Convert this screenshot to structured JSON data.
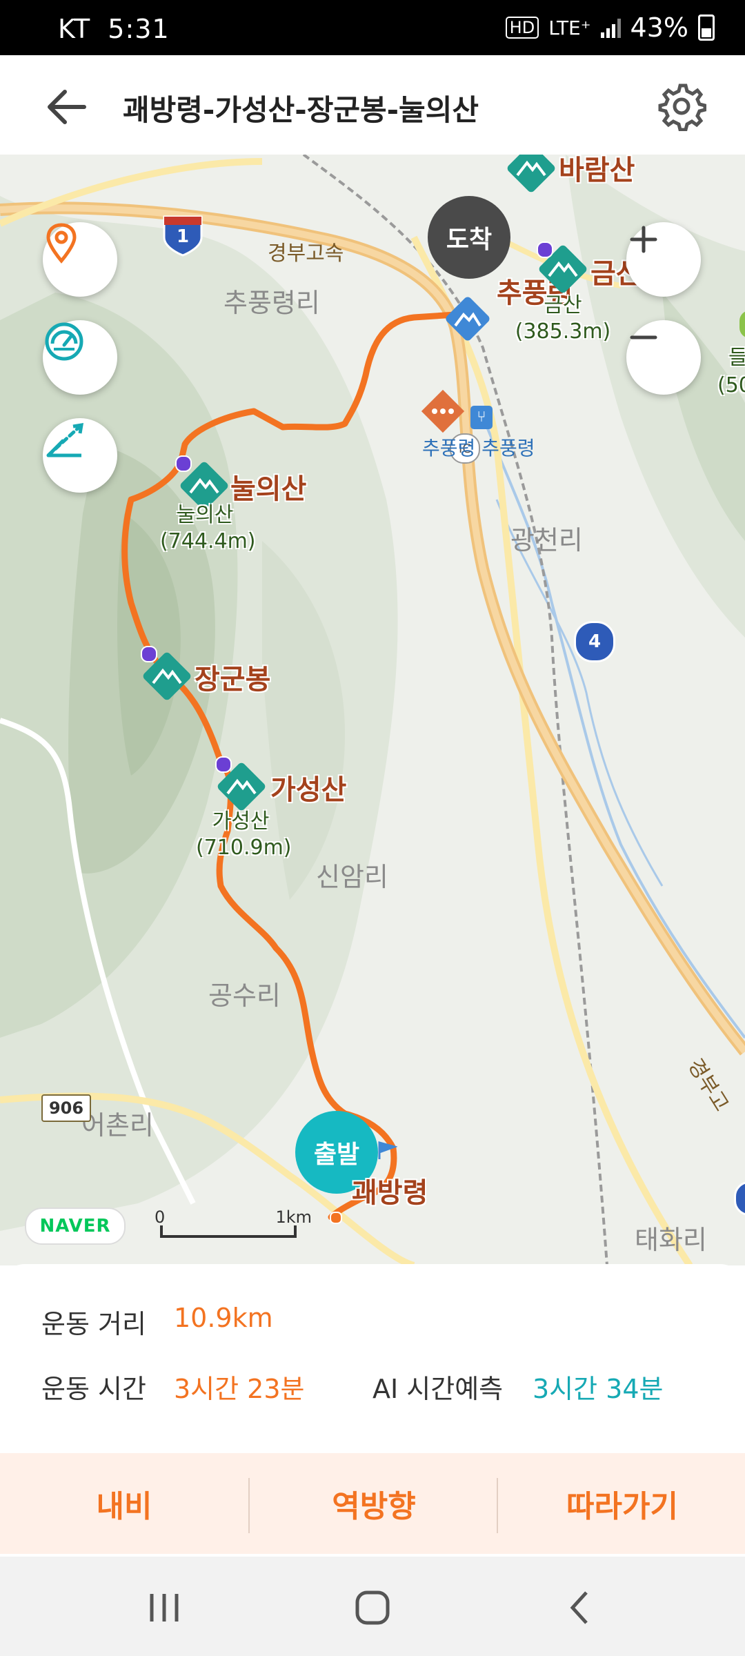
{
  "status": {
    "carrier": "KT",
    "time": "5:31",
    "hd": "HD",
    "network": "LTE⁺",
    "battery": "43%"
  },
  "header": {
    "title": "괘방령-가성산-장군봉-눌의산"
  },
  "map": {
    "place_labels": [
      "추풍령리",
      "광천리",
      "신암리",
      "공수리",
      "어촌리",
      "태화리"
    ],
    "peaks": [
      {
        "name": "눌의산",
        "sub_name": "눌의산",
        "elevation": "(744.4m)"
      },
      {
        "name": "장군봉"
      },
      {
        "name": "가성산",
        "sub_name": "가성산",
        "elevation": "(710.9m)"
      },
      {
        "name": "추풍령"
      },
      {
        "name": "금산",
        "sub_name": "금산",
        "elevation": "(385.3m)"
      },
      {
        "name": "바람산"
      }
    ],
    "road_labels": [
      "경부고속",
      "경부고"
    ],
    "road_badges": [
      "1",
      "4",
      "906"
    ],
    "ic_badge": "IC",
    "poi_label": "추풍령 추풍령",
    "edge_labels": [
      "들",
      "(50"
    ],
    "end_pin": "도착",
    "start_pin": "출발",
    "start_label": "괘방령",
    "logo": "NAVER",
    "scale": {
      "start": "0",
      "end": "1km"
    },
    "colors": {
      "route": "#f37321",
      "peak_marker": "#1f9e8e",
      "start_pin": "#16b9c2"
    }
  },
  "stats": {
    "distance_label": "운동 거리",
    "distance_value": "10.9km",
    "time_label": "운동 시간",
    "time_value": "3시간 23분",
    "ai_label": "AI 시간예측",
    "ai_value": "3시간 34분"
  },
  "actions": {
    "navigate": "내비",
    "reverse": "역방향",
    "follow": "따라가기"
  }
}
